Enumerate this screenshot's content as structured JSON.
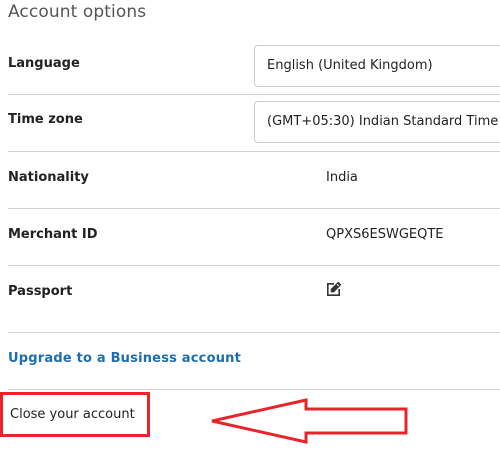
{
  "section": {
    "title": "Account options"
  },
  "rows": {
    "language": {
      "label": "Language",
      "value": "English (United Kingdom)"
    },
    "timezone": {
      "label": "Time zone",
      "value": "(GMT+05:30) Indian Standard Time"
    },
    "nationality": {
      "label": "Nationality",
      "value": "India"
    },
    "merchant_id": {
      "label": "Merchant ID",
      "value": "QPXS6ESWGEQTE"
    },
    "passport": {
      "label": "Passport",
      "icon": "edit-icon"
    }
  },
  "links": {
    "upgrade": "Upgrade to a Business account",
    "close_account": "Close your account"
  },
  "colors": {
    "link": "#1f6db0",
    "highlight": "#e8242a",
    "divider": "#d4d4d4",
    "title": "#555555"
  }
}
